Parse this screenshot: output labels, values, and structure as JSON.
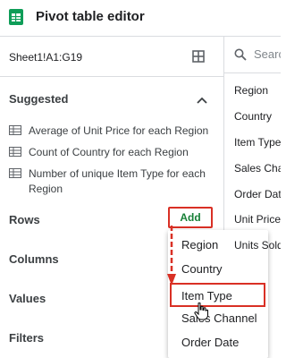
{
  "header": {
    "title": "Pivot table editor",
    "icon": "sheets-icon"
  },
  "range": {
    "value": "Sheet1!A1:G19",
    "icon": "select-range-icon"
  },
  "suggested": {
    "title": "Suggested",
    "items": [
      {
        "label": "Average of Unit Price for each Region"
      },
      {
        "label": "Count of Country for each Region"
      },
      {
        "label": "Number of unique Item Type for each Region"
      }
    ]
  },
  "sections": {
    "rows": "Rows",
    "columns": "Columns",
    "values": "Values",
    "filters": "Filters"
  },
  "add_button": {
    "label": "Add"
  },
  "menu": {
    "items": [
      {
        "label": "Region"
      },
      {
        "label": "Country"
      },
      {
        "label": "Item Type",
        "highlighted": true
      },
      {
        "label": "Sales Channel"
      },
      {
        "label": "Order Date"
      }
    ]
  },
  "search": {
    "placeholder": "Search"
  },
  "fields": [
    "Region",
    "Country",
    "Item Type",
    "Sales Channel",
    "Order Date",
    "Unit Price",
    "Units Sold"
  ],
  "colors": {
    "accent_red": "#d93025",
    "add_green": "#188038",
    "sheets_green": "#0f9d58"
  }
}
